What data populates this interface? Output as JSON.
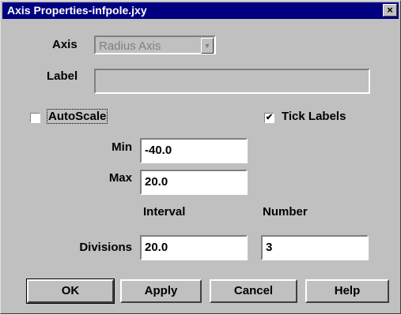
{
  "window": {
    "title": "Axis Properties-infpole.jxy",
    "close_glyph": "×"
  },
  "axis": {
    "label": "Axis",
    "value": "Radius Axis"
  },
  "label_field": {
    "label": "Label",
    "value": ""
  },
  "autoscale": {
    "label": "AutoScale",
    "checked": false,
    "check_glyph": ""
  },
  "tick_labels": {
    "label": "Tick Labels",
    "checked": true,
    "check_glyph": "✔"
  },
  "min": {
    "label": "Min",
    "value": "-40.0"
  },
  "max": {
    "label": "Max",
    "value": "20.0"
  },
  "columns": {
    "interval": "Interval",
    "number": "Number"
  },
  "divisions": {
    "label": "Divisions",
    "interval": "20.0",
    "number": "3"
  },
  "buttons": {
    "ok": "OK",
    "apply": "Apply",
    "cancel": "Cancel",
    "help": "Help"
  }
}
